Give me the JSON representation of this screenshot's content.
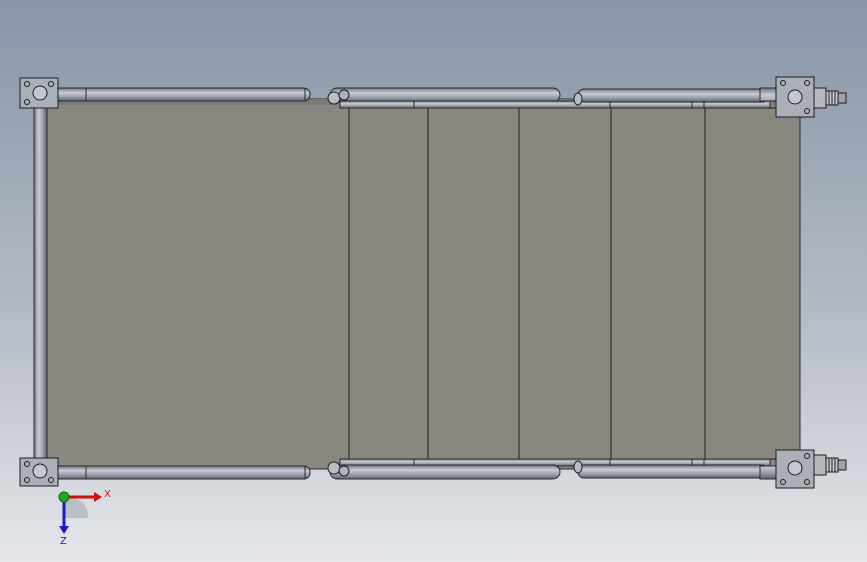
{
  "viewport": {
    "background_top": "#8a97a8",
    "background_bottom": "#e4e6e9",
    "panel_color": "#8a8780",
    "tube_color": "#8f95a0",
    "tube_highlight": "#c7cbd2",
    "edge_color": "#1c1c1c",
    "bracket_color": "#a9aeb6"
  },
  "triad": {
    "x_label": "X",
    "y_label": "Z",
    "x_color": "#cc1111",
    "y_color": "#1a1acc",
    "origin_color": "#22aa22"
  },
  "model": {
    "panel_count": 5
  }
}
